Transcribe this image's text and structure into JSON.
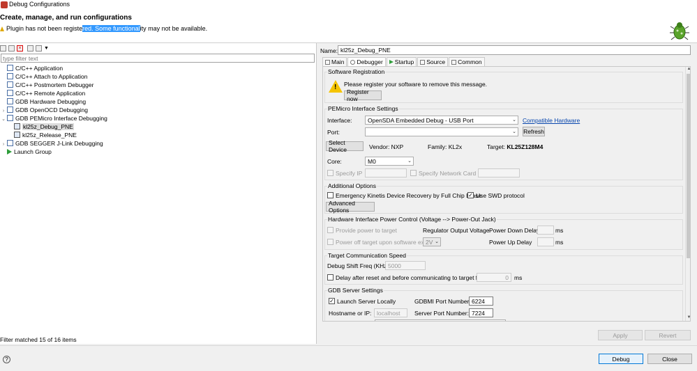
{
  "window": {
    "title": "Debug Configurations"
  },
  "header": {
    "heading": "Create, manage, and run configurations",
    "warning_pre": "Plugin has not been registe",
    "warning_sel": "red. Some functional",
    "warning_post": "ity may not be available."
  },
  "left": {
    "filter_placeholder": "type filter text",
    "tree": [
      {
        "label": "C/C++ Application"
      },
      {
        "label": "C/C++ Attach to Application"
      },
      {
        "label": "C/C++ Postmortem Debugger"
      },
      {
        "label": "C/C++ Remote Application"
      },
      {
        "label": "GDB Hardware Debugging"
      },
      {
        "label": "GDB OpenOCD Debugging"
      },
      {
        "label": "GDB PEMicro Interface Debugging"
      },
      {
        "label": "kl25z_Debug_PNE"
      },
      {
        "label": "kl25z_Release_PNE"
      },
      {
        "label": "GDB SEGGER J-Link Debugging"
      },
      {
        "label": "Launch Group"
      }
    ],
    "filter_status": "Filter matched 15 of 16 items"
  },
  "right": {
    "name_label": "Name:",
    "name_value": "kl25z_Debug_PNE",
    "tabs": [
      {
        "label": "Main"
      },
      {
        "label": "Debugger"
      },
      {
        "label": "Startup"
      },
      {
        "label": "Source"
      },
      {
        "label": "Common"
      }
    ],
    "software_registration": {
      "title": "Software Registration",
      "message": "Please register your software to remove this message.",
      "button": "Register now"
    },
    "pemicro": {
      "title": "PEMicro Interface Settings",
      "interface_label": "Interface:",
      "interface_value": "OpenSDA Embedded Debug - USB Port",
      "compatible_link": "Compatible Hardware",
      "port_label": "Port:",
      "port_value": "",
      "refresh": "Refresh",
      "select_device": "Select Device",
      "vendor": "Vendor: NXP",
      "family": "Family: KL2x",
      "target_label": "Target:",
      "target_value": "KL25Z128M4",
      "core_label": "Core:",
      "core_value": "M0",
      "specify_ip": "Specify IP",
      "specify_network": "Specify Network Card IP"
    },
    "additional": {
      "title": "Additional Options",
      "emergency": "Emergency Kinetis Device Recovery by Full Chip Erase",
      "use_swd": "Use SWD protocol",
      "advanced": "Advanced Options"
    },
    "power": {
      "title": "Hardware Interface Power Control (Voltage --> Power-Out Jack)",
      "provide_power": "Provide power to target",
      "regulator": "Regulator Output Voltage",
      "power_down": "Power Down Delay",
      "ms1": "ms",
      "power_off": "Power off target upon software exit",
      "voltage": "2V",
      "power_up": "Power Up Delay",
      "ms2": "ms"
    },
    "speed": {
      "title": "Target Communication Speed",
      "shift_label": "Debug Shift Freq (KHz)",
      "shift_value": "5000",
      "delay_label": "Delay after reset and before communicating to target for",
      "delay_value": "0",
      "delay_unit": "ms"
    },
    "gdb": {
      "title": "GDB Server Settings",
      "launch_local": "Launch Server Locally",
      "gdbmi_label": "GDBMI Port Number:",
      "gdbmi_value": "6224",
      "host_label": "Hostname or IP:",
      "host_value": "localhost",
      "server_port_label": "Server Port Number:",
      "server_port_value": "7224"
    },
    "apply": "Apply",
    "revert": "Revert"
  },
  "footer": {
    "help": "?",
    "debug": "Debug",
    "close": "Close"
  }
}
